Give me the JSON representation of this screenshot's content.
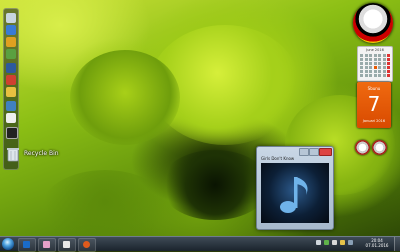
{
  "desktop": {
    "icons": [
      {
        "label": "Recycle Bin",
        "icon": "recycle-bin-icon"
      }
    ]
  },
  "sidebar": {
    "icons": [
      "app-icon",
      "app-icon",
      "app-icon",
      "app-icon",
      "app-icon",
      "app-icon",
      "app-icon",
      "app-icon",
      "app-icon",
      "app-icon"
    ]
  },
  "gadgets": {
    "calendar": {
      "title": "June 2016"
    },
    "date": {
      "weekday": "Sbunu",
      "day": "7",
      "month": "Januari 2016"
    }
  },
  "media_player": {
    "title": "Girls Don't Know",
    "icon": "music-note-icon"
  },
  "taskbar": {
    "clock_time": "20:04",
    "clock_date": "07.01.2016",
    "buttons": [
      "start-button",
      "app-button",
      "app-button",
      "app-button",
      "app-button"
    ]
  },
  "colors": {
    "accent_orange": "#e85a00",
    "taskbar": "#1f2a33",
    "music_blue": "#6fb3ea"
  }
}
